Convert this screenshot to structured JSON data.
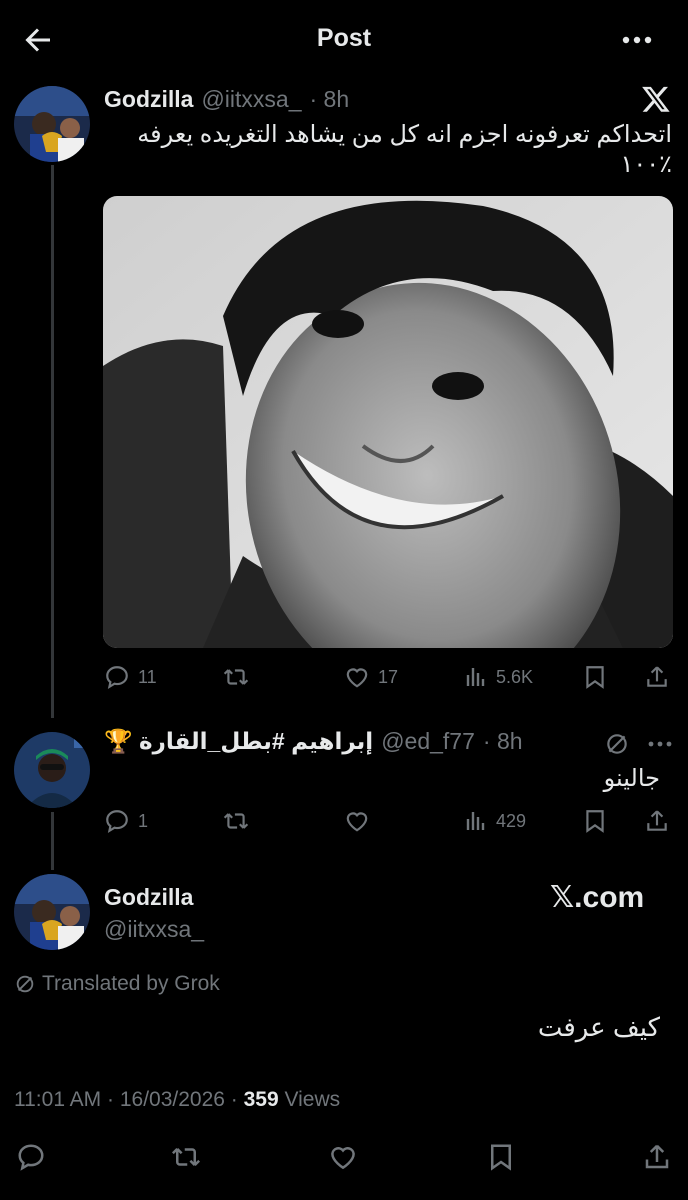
{
  "header": {
    "title": "Post"
  },
  "main_tweet": {
    "name": "Godzilla",
    "handle": "@iitxxsa_",
    "time": "· 8h",
    "text_line1": "اتحداكم تعرفونه اجزم انه كل من يشاهد التغريده يعرفه",
    "text_line2": "٪١٠٠",
    "stats": {
      "replies": "11",
      "likes": "17",
      "views": "5.6K"
    }
  },
  "reply": {
    "name": "إبراهيم #بطل_القارة 🏆",
    "handle": "@ed_f77",
    "time": "· 8h",
    "text": "جالينو",
    "stats": {
      "replies": "1",
      "views": "429"
    }
  },
  "focus_tweet": {
    "name": "Godzilla",
    "handle": "@iitxxsa_",
    "watermark": "𝕏.com",
    "translated_label": "Translated by Grok",
    "text": "كيف عرفت",
    "timestamp": "11:01 AM · 16/03/2026 · ",
    "views_count": "359",
    "views_label": " Views"
  },
  "icons": [
    "back-arrow-icon",
    "more-icon",
    "x-logo-icon",
    "reply-icon",
    "retweet-icon",
    "like-icon",
    "views-icon",
    "bookmark-icon",
    "share-icon",
    "grok-icon"
  ],
  "colors": {
    "background": "#000000",
    "text": "#e7e9ea",
    "secondary": "#71767b",
    "thread_line": "#333639"
  }
}
